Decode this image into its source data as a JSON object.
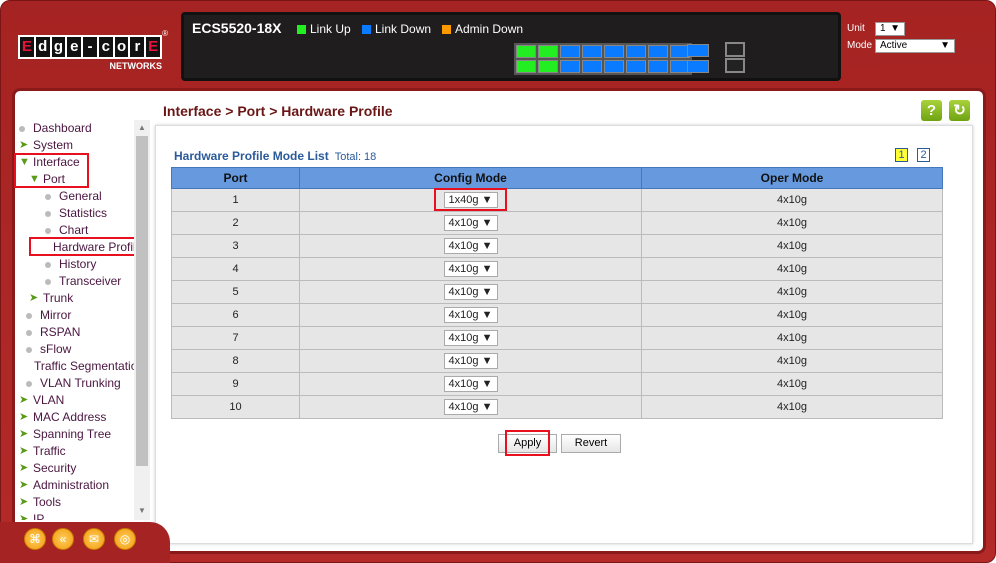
{
  "logo": {
    "letters": [
      "E",
      "d",
      "g",
      "e",
      "-",
      "c",
      "o",
      "r",
      "E"
    ],
    "sub": "NETWORKS"
  },
  "header": {
    "model": "ECS5520-18X",
    "legend": [
      {
        "label": "Link Up",
        "color": "#22ee22"
      },
      {
        "label": "Link Down",
        "color": "#0a7bff"
      },
      {
        "label": "Admin Down",
        "color": "#ff9900"
      }
    ],
    "unit_label": "Unit",
    "unit_value": "1",
    "mode_label": "Mode",
    "mode_value": "Active"
  },
  "breadcrumb": "Interface > Port > Hardware Profile",
  "icons": {
    "help": "?",
    "refresh": "↻"
  },
  "sidebar": [
    {
      "label": "Dashboard",
      "type": "dot",
      "level": 0
    },
    {
      "label": "System",
      "type": "arrow",
      "level": 0
    },
    {
      "label": "Interface",
      "type": "open",
      "level": 0
    },
    {
      "label": "Port",
      "type": "open",
      "level": 1
    },
    {
      "label": "General",
      "type": "dot",
      "level": 2
    },
    {
      "label": "Statistics",
      "type": "dot",
      "level": 2
    },
    {
      "label": "Chart",
      "type": "dot",
      "level": 2
    },
    {
      "label": "Hardware Profile",
      "type": "dot",
      "level": 2,
      "active": true
    },
    {
      "label": "History",
      "type": "dot",
      "level": 2
    },
    {
      "label": "Transceiver",
      "type": "dot",
      "level": 2
    },
    {
      "label": "Trunk",
      "type": "arrow",
      "level": 1
    },
    {
      "label": "Mirror",
      "type": "dot",
      "level": 1
    },
    {
      "label": "RSPAN",
      "type": "dot",
      "level": 1
    },
    {
      "label": "sFlow",
      "type": "dot",
      "level": 1
    },
    {
      "label": "Traffic Segmentation",
      "type": "dot",
      "level": 1
    },
    {
      "label": "VLAN Trunking",
      "type": "dot",
      "level": 1
    },
    {
      "label": "VLAN",
      "type": "arrow",
      "level": 0
    },
    {
      "label": "MAC Address",
      "type": "arrow",
      "level": 0
    },
    {
      "label": "Spanning Tree",
      "type": "arrow",
      "level": 0
    },
    {
      "label": "Traffic",
      "type": "arrow",
      "level": 0
    },
    {
      "label": "Security",
      "type": "arrow",
      "level": 0
    },
    {
      "label": "Administration",
      "type": "arrow",
      "level": 0
    },
    {
      "label": "Tools",
      "type": "arrow",
      "level": 0
    },
    {
      "label": "IP",
      "type": "arrow",
      "level": 0
    }
  ],
  "list": {
    "title": "Hardware Profile Mode List",
    "total": "Total: 18",
    "pages": [
      "1",
      "2"
    ],
    "current_page": "1",
    "columns": [
      "Port",
      "Config Mode",
      "Oper Mode"
    ],
    "rows": [
      [
        "1",
        "1x40g",
        "4x10g"
      ],
      [
        "2",
        "4x10g",
        "4x10g"
      ],
      [
        "3",
        "4x10g",
        "4x10g"
      ],
      [
        "4",
        "4x10g",
        "4x10g"
      ],
      [
        "5",
        "4x10g",
        "4x10g"
      ],
      [
        "6",
        "4x10g",
        "4x10g"
      ],
      [
        "7",
        "4x10g",
        "4x10g"
      ],
      [
        "8",
        "4x10g",
        "4x10g"
      ],
      [
        "9",
        "4x10g",
        "4x10g"
      ],
      [
        "10",
        "4x10g",
        "4x10g"
      ]
    ]
  },
  "buttons": {
    "apply": "Apply",
    "revert": "Revert"
  },
  "bottom_icons": [
    "sitemap-icon",
    "back-icon",
    "mail-icon",
    "globe-icon"
  ]
}
